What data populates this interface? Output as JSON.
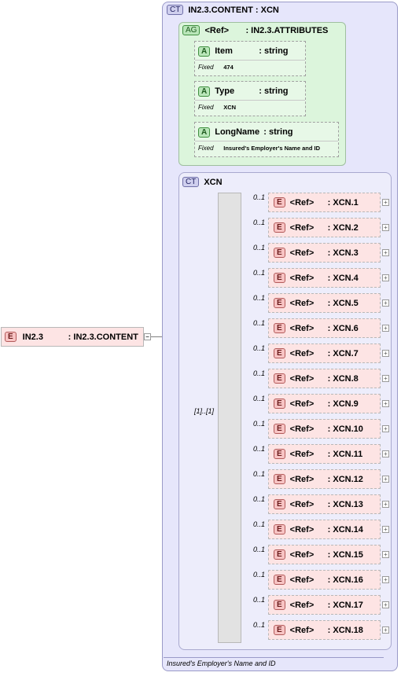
{
  "root_element": {
    "badge": "E",
    "name": "IN2.3",
    "type": ": IN2.3.CONTENT"
  },
  "content_type": {
    "badge": "CT",
    "title": "IN2.3.CONTENT : XCN"
  },
  "attribute_group": {
    "badge": "AG",
    "ref": "<Ref>",
    "type": ": IN2.3.ATTRIBUTES"
  },
  "attributes": [
    {
      "badge": "A",
      "name": "Item",
      "type": ": string",
      "fixed_label": "Fixed",
      "fixed_value": "474"
    },
    {
      "badge": "A",
      "name": "Type",
      "type": ": string",
      "fixed_label": "Fixed",
      "fixed_value": "XCN"
    },
    {
      "badge": "A",
      "name": "LongName",
      "type": ": string",
      "fixed_label": "Fixed",
      "fixed_value": "Insured's Employer's Name and ID"
    }
  ],
  "complex_type": {
    "badge": "CT",
    "title": "XCN"
  },
  "sequence": {
    "occurrence": "[1]..[1]"
  },
  "children": [
    {
      "occurrence": "0..1",
      "badge": "E",
      "ref": "<Ref>",
      "type": ": XCN.1"
    },
    {
      "occurrence": "0..1",
      "badge": "E",
      "ref": "<Ref>",
      "type": ": XCN.2"
    },
    {
      "occurrence": "0..1",
      "badge": "E",
      "ref": "<Ref>",
      "type": ": XCN.3"
    },
    {
      "occurrence": "0..1",
      "badge": "E",
      "ref": "<Ref>",
      "type": ": XCN.4"
    },
    {
      "occurrence": "0..1",
      "badge": "E",
      "ref": "<Ref>",
      "type": ": XCN.5"
    },
    {
      "occurrence": "0..1",
      "badge": "E",
      "ref": "<Ref>",
      "type": ": XCN.6"
    },
    {
      "occurrence": "0..1",
      "badge": "E",
      "ref": "<Ref>",
      "type": ": XCN.7"
    },
    {
      "occurrence": "0..1",
      "badge": "E",
      "ref": "<Ref>",
      "type": ": XCN.8"
    },
    {
      "occurrence": "0..1",
      "badge": "E",
      "ref": "<Ref>",
      "type": ": XCN.9"
    },
    {
      "occurrence": "0..1",
      "badge": "E",
      "ref": "<Ref>",
      "type": ": XCN.10"
    },
    {
      "occurrence": "0..1",
      "badge": "E",
      "ref": "<Ref>",
      "type": ": XCN.11"
    },
    {
      "occurrence": "0..1",
      "badge": "E",
      "ref": "<Ref>",
      "type": ": XCN.12"
    },
    {
      "occurrence": "0..1",
      "badge": "E",
      "ref": "<Ref>",
      "type": ": XCN.13"
    },
    {
      "occurrence": "0..1",
      "badge": "E",
      "ref": "<Ref>",
      "type": ": XCN.14"
    },
    {
      "occurrence": "0..1",
      "badge": "E",
      "ref": "<Ref>",
      "type": ": XCN.15"
    },
    {
      "occurrence": "0..1",
      "badge": "E",
      "ref": "<Ref>",
      "type": ": XCN.16"
    },
    {
      "occurrence": "0..1",
      "badge": "E",
      "ref": "<Ref>",
      "type": ": XCN.17"
    },
    {
      "occurrence": "0..1",
      "badge": "E",
      "ref": "<Ref>",
      "type": ": XCN.18"
    }
  ],
  "documentation": "Insured's Employer's Name and ID",
  "colors": {
    "element_fill": "#fde4e4",
    "attribute_fill": "#e7f8e7",
    "complex_type_fill": "#e6e6fb",
    "connector": "#808080"
  }
}
